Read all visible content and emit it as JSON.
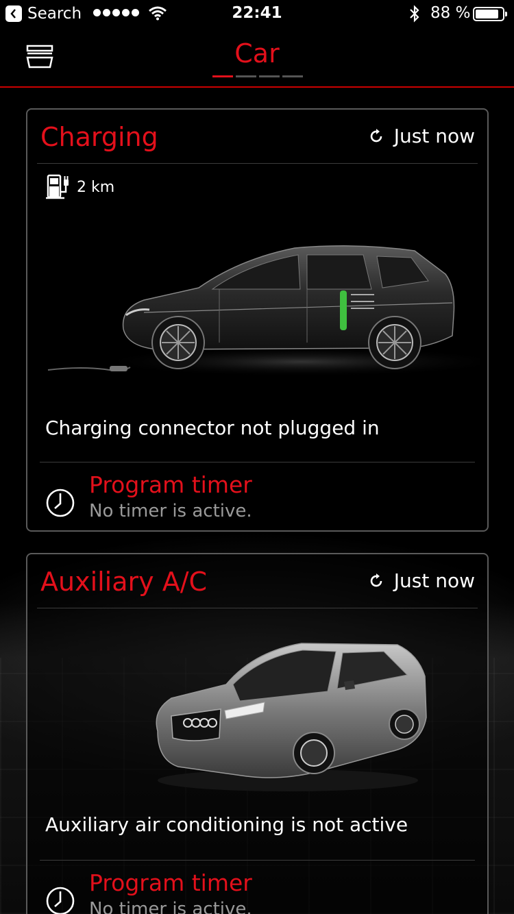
{
  "status_bar": {
    "back_label": "Search",
    "time": "22:41",
    "battery_percent": "88 %",
    "battery_level": 0.88
  },
  "nav": {
    "title": "Car",
    "page_count": 4,
    "active_page": 0
  },
  "cards": {
    "charging": {
      "title": "Charging",
      "refresh_label": "Just now",
      "range": "2 km",
      "status": "Charging connector not plugged in",
      "timer_title": "Program timer",
      "timer_subtitle": "No timer is active."
    },
    "aux_ac": {
      "title": "Auxiliary A/C",
      "refresh_label": "Just now",
      "status": "Auxiliary air conditioning is not active",
      "timer_title": "Program timer",
      "timer_subtitle": "No timer is active."
    }
  },
  "colors": {
    "accent": "#e3101b",
    "background": "#000000",
    "card_border": "#5a5a5a",
    "muted_text": "#9a9a9a",
    "charge_indicator": "#3fbf3f"
  },
  "icons": {
    "menu": "garage-menu-icon",
    "refresh": "refresh-icon",
    "range": "charging-station-icon",
    "timer": "clock-icon"
  }
}
